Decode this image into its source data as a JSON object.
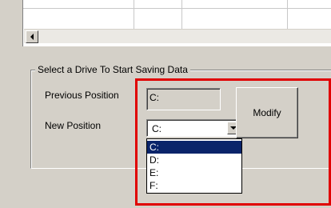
{
  "group": {
    "title": "Select a Drive To Start Saving Data"
  },
  "previous": {
    "label": "Previous Position",
    "value": "C:"
  },
  "new_position": {
    "label": "New Position",
    "selected": "C:"
  },
  "modify_button": {
    "label": "Modify"
  },
  "dropdown": {
    "options": [
      "C:",
      "D:",
      "E:",
      "F:"
    ],
    "selected_index": 0
  },
  "colors": {
    "highlight": "#e00000",
    "selection": "#0a246a",
    "face": "#d4d0c8"
  },
  "icons": {
    "scroll_left": "left-arrow-icon",
    "combo_dropdown": "down-arrow-icon"
  }
}
